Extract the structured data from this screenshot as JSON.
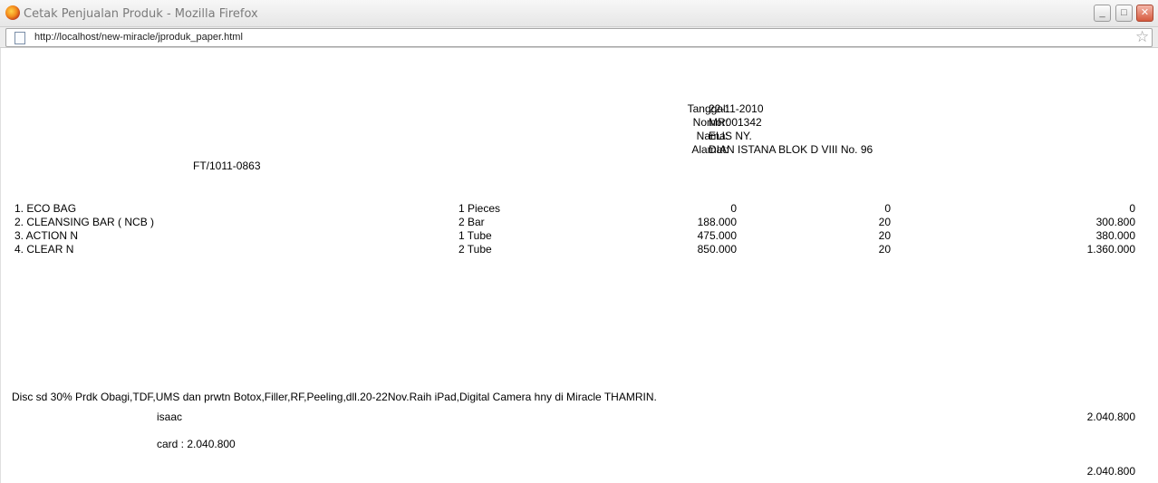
{
  "window": {
    "title": "Cetak Penjualan Produk - Mozilla Firefox",
    "url": "http://localhost/new-miracle/jproduk_paper.html",
    "minimize_glyph": "_",
    "maximize_glyph": "□",
    "close_glyph": "✕"
  },
  "header": {
    "labels": [
      "Tanggal:",
      "Nomor:",
      "Nama:",
      "Alamat:"
    ],
    "values": [
      "22-11-2010",
      "MR001342",
      "ELIS NY.",
      "DIAN ISTANA BLOK D VIII No. 96"
    ],
    "faktur": "FT/1011-0863"
  },
  "items": [
    {
      "name": "1. ECO BAG",
      "qty": "1 Pieces",
      "price": "0",
      "disc": "0",
      "subtotal": "0"
    },
    {
      "name": "2. CLEANSING BAR ( NCB )",
      "qty": "2 Bar",
      "price": "188.000",
      "disc": "20",
      "subtotal": "300.800"
    },
    {
      "name": "3. ACTION N",
      "qty": "1 Tube",
      "price": "475.000",
      "disc": "20",
      "subtotal": "380.000"
    },
    {
      "name": "4. CLEAR N",
      "qty": "2 Tube",
      "price": "850.000",
      "disc": "20",
      "subtotal": "1.360.000"
    }
  ],
  "footer": {
    "note": "Disc sd 30% Prdk Obagi,TDF,UMS dan prwtn Botox,Filler,RF,Peeling,dll.20-22Nov.Raih iPad,Digital Camera hny di Miracle THAMRIN.",
    "cashier": "isaac",
    "total": "2.040.800",
    "payment": "card : 2.040.800",
    "grand_total": "2.040.800"
  }
}
